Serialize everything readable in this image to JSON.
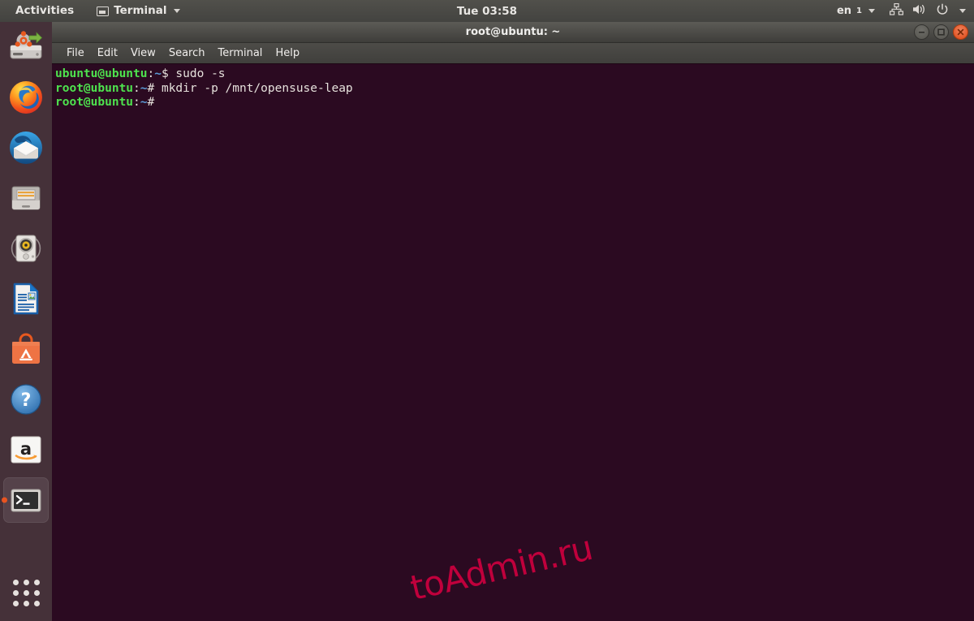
{
  "topbar": {
    "activities_label": "Activities",
    "app_menu_label": "Terminal",
    "app_menu_icon": "window-icon",
    "clock": "Tue 03:58",
    "input_source": "en",
    "input_source_sub": "1",
    "icons": [
      "network-icon",
      "volume-icon",
      "power-icon",
      "chevron-down-icon"
    ]
  },
  "dock": {
    "items": [
      {
        "name": "install-ubuntu",
        "label": "Install Ubuntu",
        "icon": "install-ubuntu-icon",
        "active": false,
        "running": false
      },
      {
        "name": "firefox",
        "label": "Firefox Web Browser",
        "icon": "firefox-icon",
        "active": false,
        "running": false
      },
      {
        "name": "thunderbird",
        "label": "Thunderbird Mail",
        "icon": "thunderbird-icon",
        "active": false,
        "running": false
      },
      {
        "name": "files",
        "label": "Files",
        "icon": "files-icon",
        "active": false,
        "running": false
      },
      {
        "name": "rhythmbox",
        "label": "Rhythmbox",
        "icon": "rhythmbox-icon",
        "active": false,
        "running": false
      },
      {
        "name": "libreoffice-writer",
        "label": "LibreOffice Writer",
        "icon": "libreoffice-writer-icon",
        "active": false,
        "running": false
      },
      {
        "name": "ubuntu-software",
        "label": "Ubuntu Software",
        "icon": "ubuntu-software-icon",
        "active": false,
        "running": false
      },
      {
        "name": "help",
        "label": "Help",
        "icon": "help-icon",
        "active": false,
        "running": false
      },
      {
        "name": "amazon",
        "label": "Amazon",
        "icon": "amazon-icon",
        "active": false,
        "running": false
      },
      {
        "name": "terminal",
        "label": "Terminal",
        "icon": "terminal-icon",
        "active": true,
        "running": true
      }
    ],
    "show_apps_label": "Show Applications",
    "show_apps_icon": "grid-dots-icon"
  },
  "window": {
    "title": "root@ubuntu: ~",
    "controls": {
      "minimize": "minimize-button",
      "maximize": "maximize-button",
      "close": "close-button"
    },
    "menu": [
      {
        "name": "file",
        "label": "File"
      },
      {
        "name": "edit",
        "label": "Edit"
      },
      {
        "name": "view",
        "label": "View"
      },
      {
        "name": "search",
        "label": "Search"
      },
      {
        "name": "terminal",
        "label": "Terminal"
      },
      {
        "name": "help",
        "label": "Help"
      }
    ]
  },
  "terminal": {
    "colors": {
      "background": "#2b0a21",
      "foreground": "#e6e1dc",
      "prompt_user": "#4ee24e",
      "prompt_path": "#5c9bd6"
    },
    "lines": [
      {
        "user": "ubuntu@ubuntu",
        "sep": ":",
        "path": "~",
        "sigil": "$",
        "command": " sudo -s"
      },
      {
        "user": "root@ubuntu",
        "sep": ":",
        "path": "~",
        "sigil": "#",
        "command": " mkdir -p /mnt/opensuse-leap"
      },
      {
        "user": "root@ubuntu",
        "sep": ":",
        "path": "~",
        "sigil": "#",
        "command": ""
      }
    ]
  },
  "watermark": {
    "text": "toAdmin.ru",
    "color": "#c0003c"
  }
}
